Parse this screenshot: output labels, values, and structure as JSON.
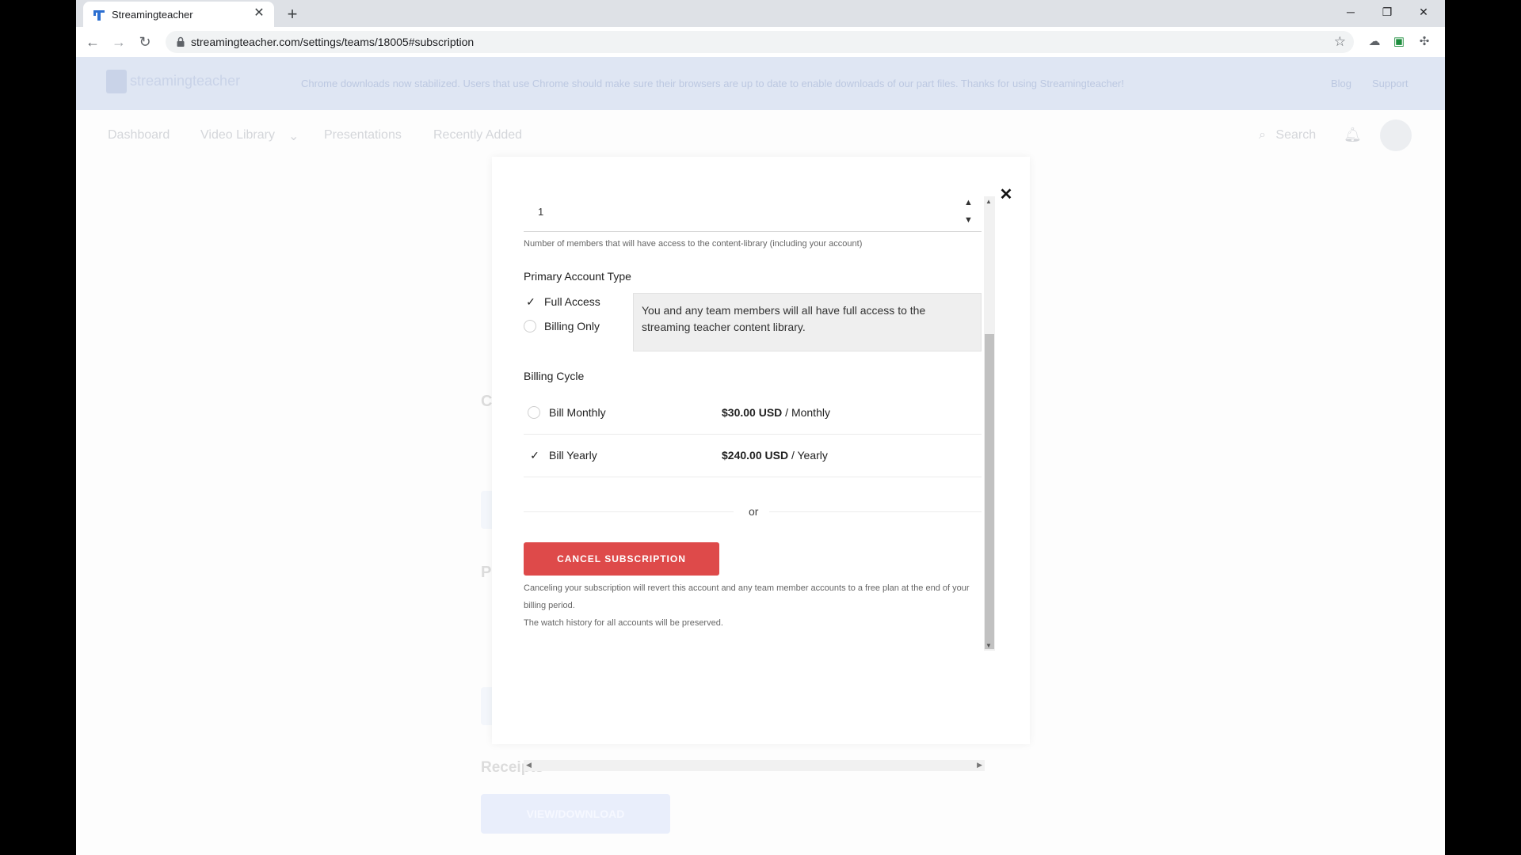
{
  "browser": {
    "tab_title": "Streamingteacher",
    "tab_close": "✕",
    "new_tab": "+",
    "url": "streamingteacher.com/settings/teams/18005#subscription",
    "window_controls": [
      "─",
      "❐",
      "✕"
    ]
  },
  "site": {
    "logo_text": "streamingteacher",
    "banner_message": "Chrome downloads now stabilized. Users that use Chrome should make sure their browsers are up to date to enable downloads of our part files. Thanks for using Streamingteacher!",
    "banner_links": [
      "Blog",
      "Support"
    ],
    "nav": [
      "Dashboard",
      "Video Library",
      "Presentations",
      "Recently Added"
    ],
    "nav_dropdown_icon": "⌄",
    "search_label": "Search"
  },
  "background": {
    "letters": [
      "C",
      "P"
    ],
    "receipts_heading": "Receipts",
    "receipts_button": "VIEW/DOWNLOAD"
  },
  "modal": {
    "close": "✕",
    "members_value": "1",
    "members_help": "Number of members that will have access to the content-library (including your account)",
    "account_type_title": "Primary Account Type",
    "account_types": [
      {
        "label": "Full Access",
        "selected": true
      },
      {
        "label": "Billing Only",
        "selected": false
      }
    ],
    "account_type_description": "You and any team members will all have full access to the streaming teacher content library.",
    "billing_cycle_title": "Billing Cycle",
    "billing_options": [
      {
        "label": "Bill Monthly",
        "amount": "$30.00 USD",
        "period": " / Monthly",
        "selected": false
      },
      {
        "label": "Bill Yearly",
        "amount": "$240.00 USD",
        "period": " / Yearly",
        "selected": true
      }
    ],
    "or_text": "or",
    "cancel_button": "CANCEL SUBSCRIPTION",
    "cancel_note_1": "Canceling your subscription will revert this account and any team member accounts to a free plan at the end of your billing period.",
    "cancel_note_2": "The watch history for all accounts will be preserved."
  }
}
